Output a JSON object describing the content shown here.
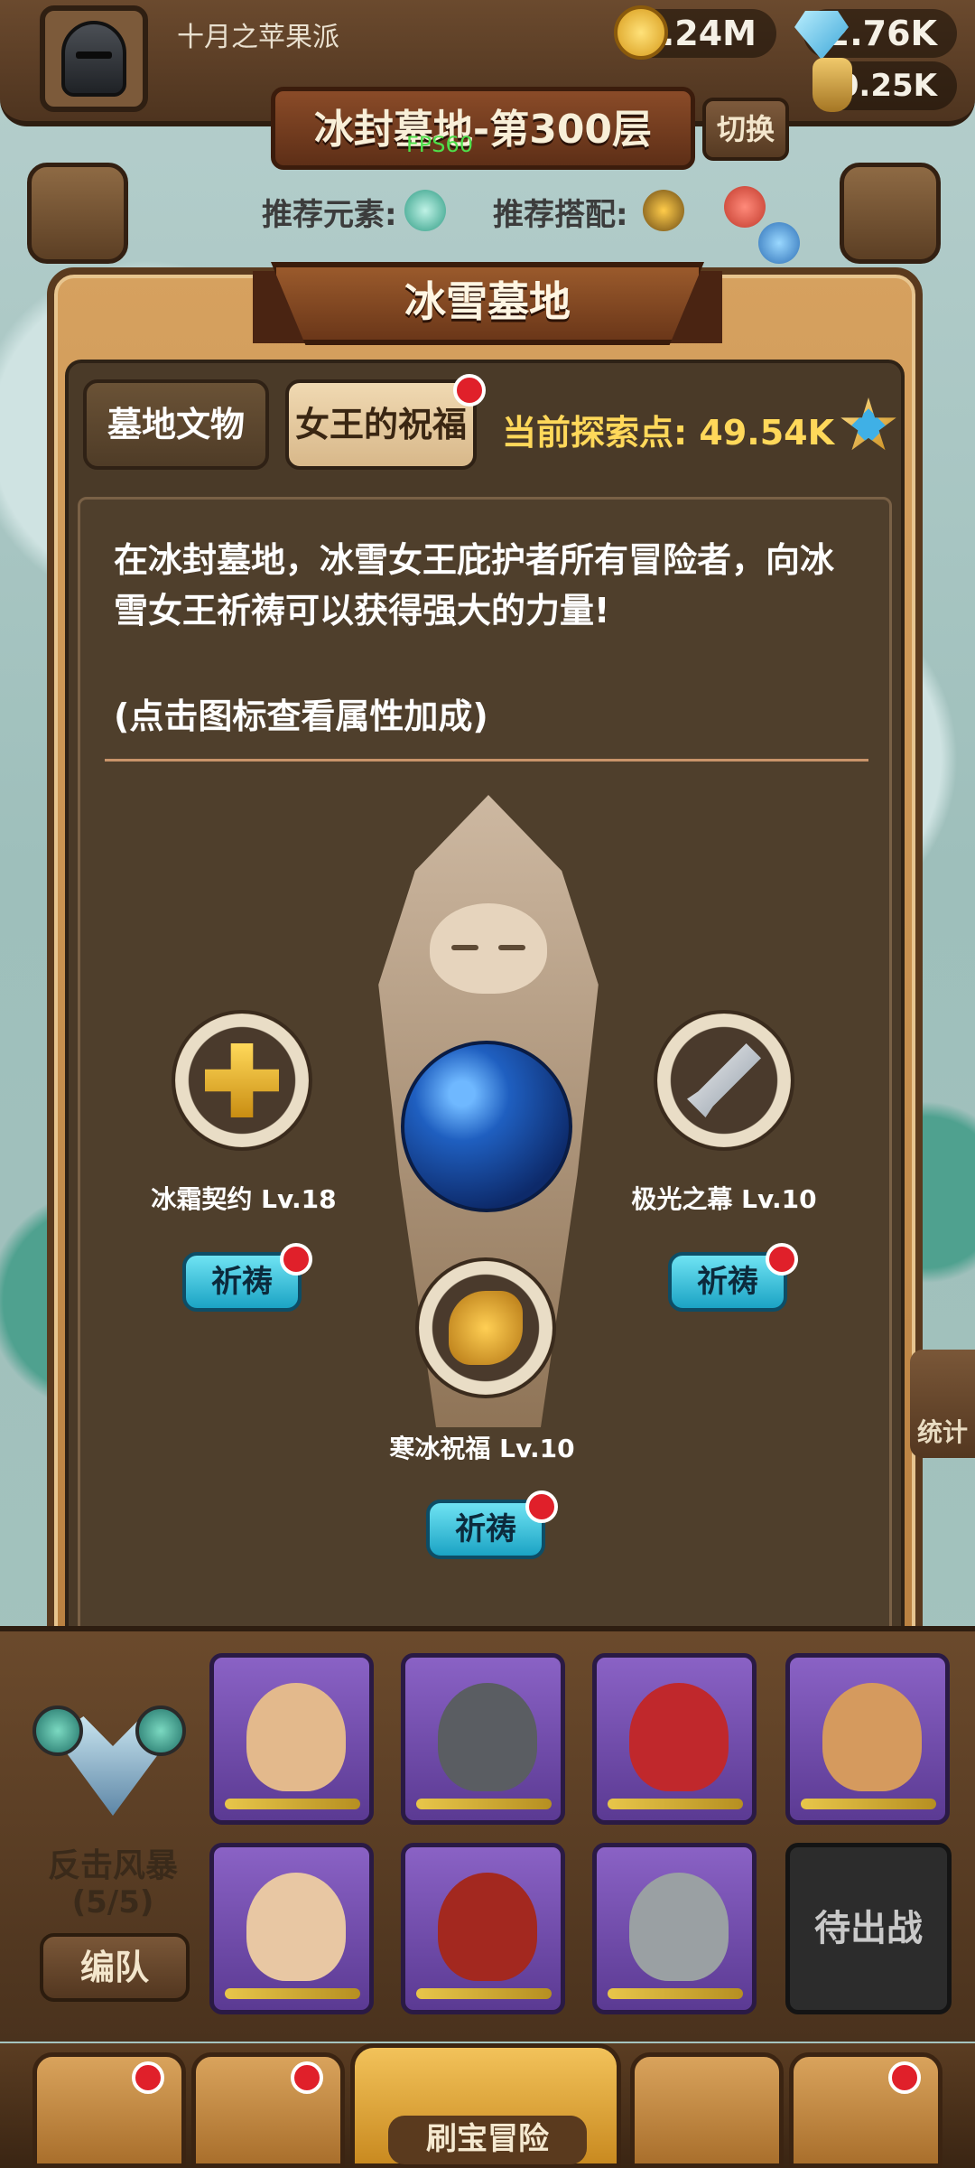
{
  "header": {
    "player_name": "十月之苹果派",
    "gold": "1.24M",
    "gems": "2.76K",
    "potion": "30.25K",
    "floor_title": "冰封墓地-第300层",
    "fps": "FPS60",
    "switch_label": "切换",
    "recommend_element_label": "推荐元素:",
    "recommend_match_label": "推荐搭配:"
  },
  "dialog": {
    "title": "冰雪墓地",
    "tabs": [
      {
        "label": "墓地文物"
      },
      {
        "label": "女王的祝福"
      }
    ],
    "explore_label": "当前探索点: 49.54K",
    "description": "在冰封墓地，冰雪女王庇护者所有冒险者，向冰雪女王祈祷可以获得强大的力量!",
    "hint": "(点击图标查看属性加成)",
    "relics": [
      {
        "name": "冰霜契约 Lv.18",
        "button": "祈祷"
      },
      {
        "name": "极光之幕 Lv.10",
        "button": "祈祷"
      },
      {
        "name": "寒冰祝福 Lv.10",
        "button": "祈祷"
      }
    ]
  },
  "team": {
    "formation_name": "反击风暴",
    "formation_count": "(5/5)",
    "team_button": "编队",
    "standby_label": "待出战",
    "stats_label": "统计"
  },
  "nav": {
    "main_label": "刷宝冒险"
  },
  "colors": {
    "frame_brown": "#5a3a1e",
    "panel_dark": "#4a3a28",
    "accent_yellow": "#ffd85a",
    "pray_cyan": "#1ba3c4",
    "notify_red": "#e0202a"
  }
}
